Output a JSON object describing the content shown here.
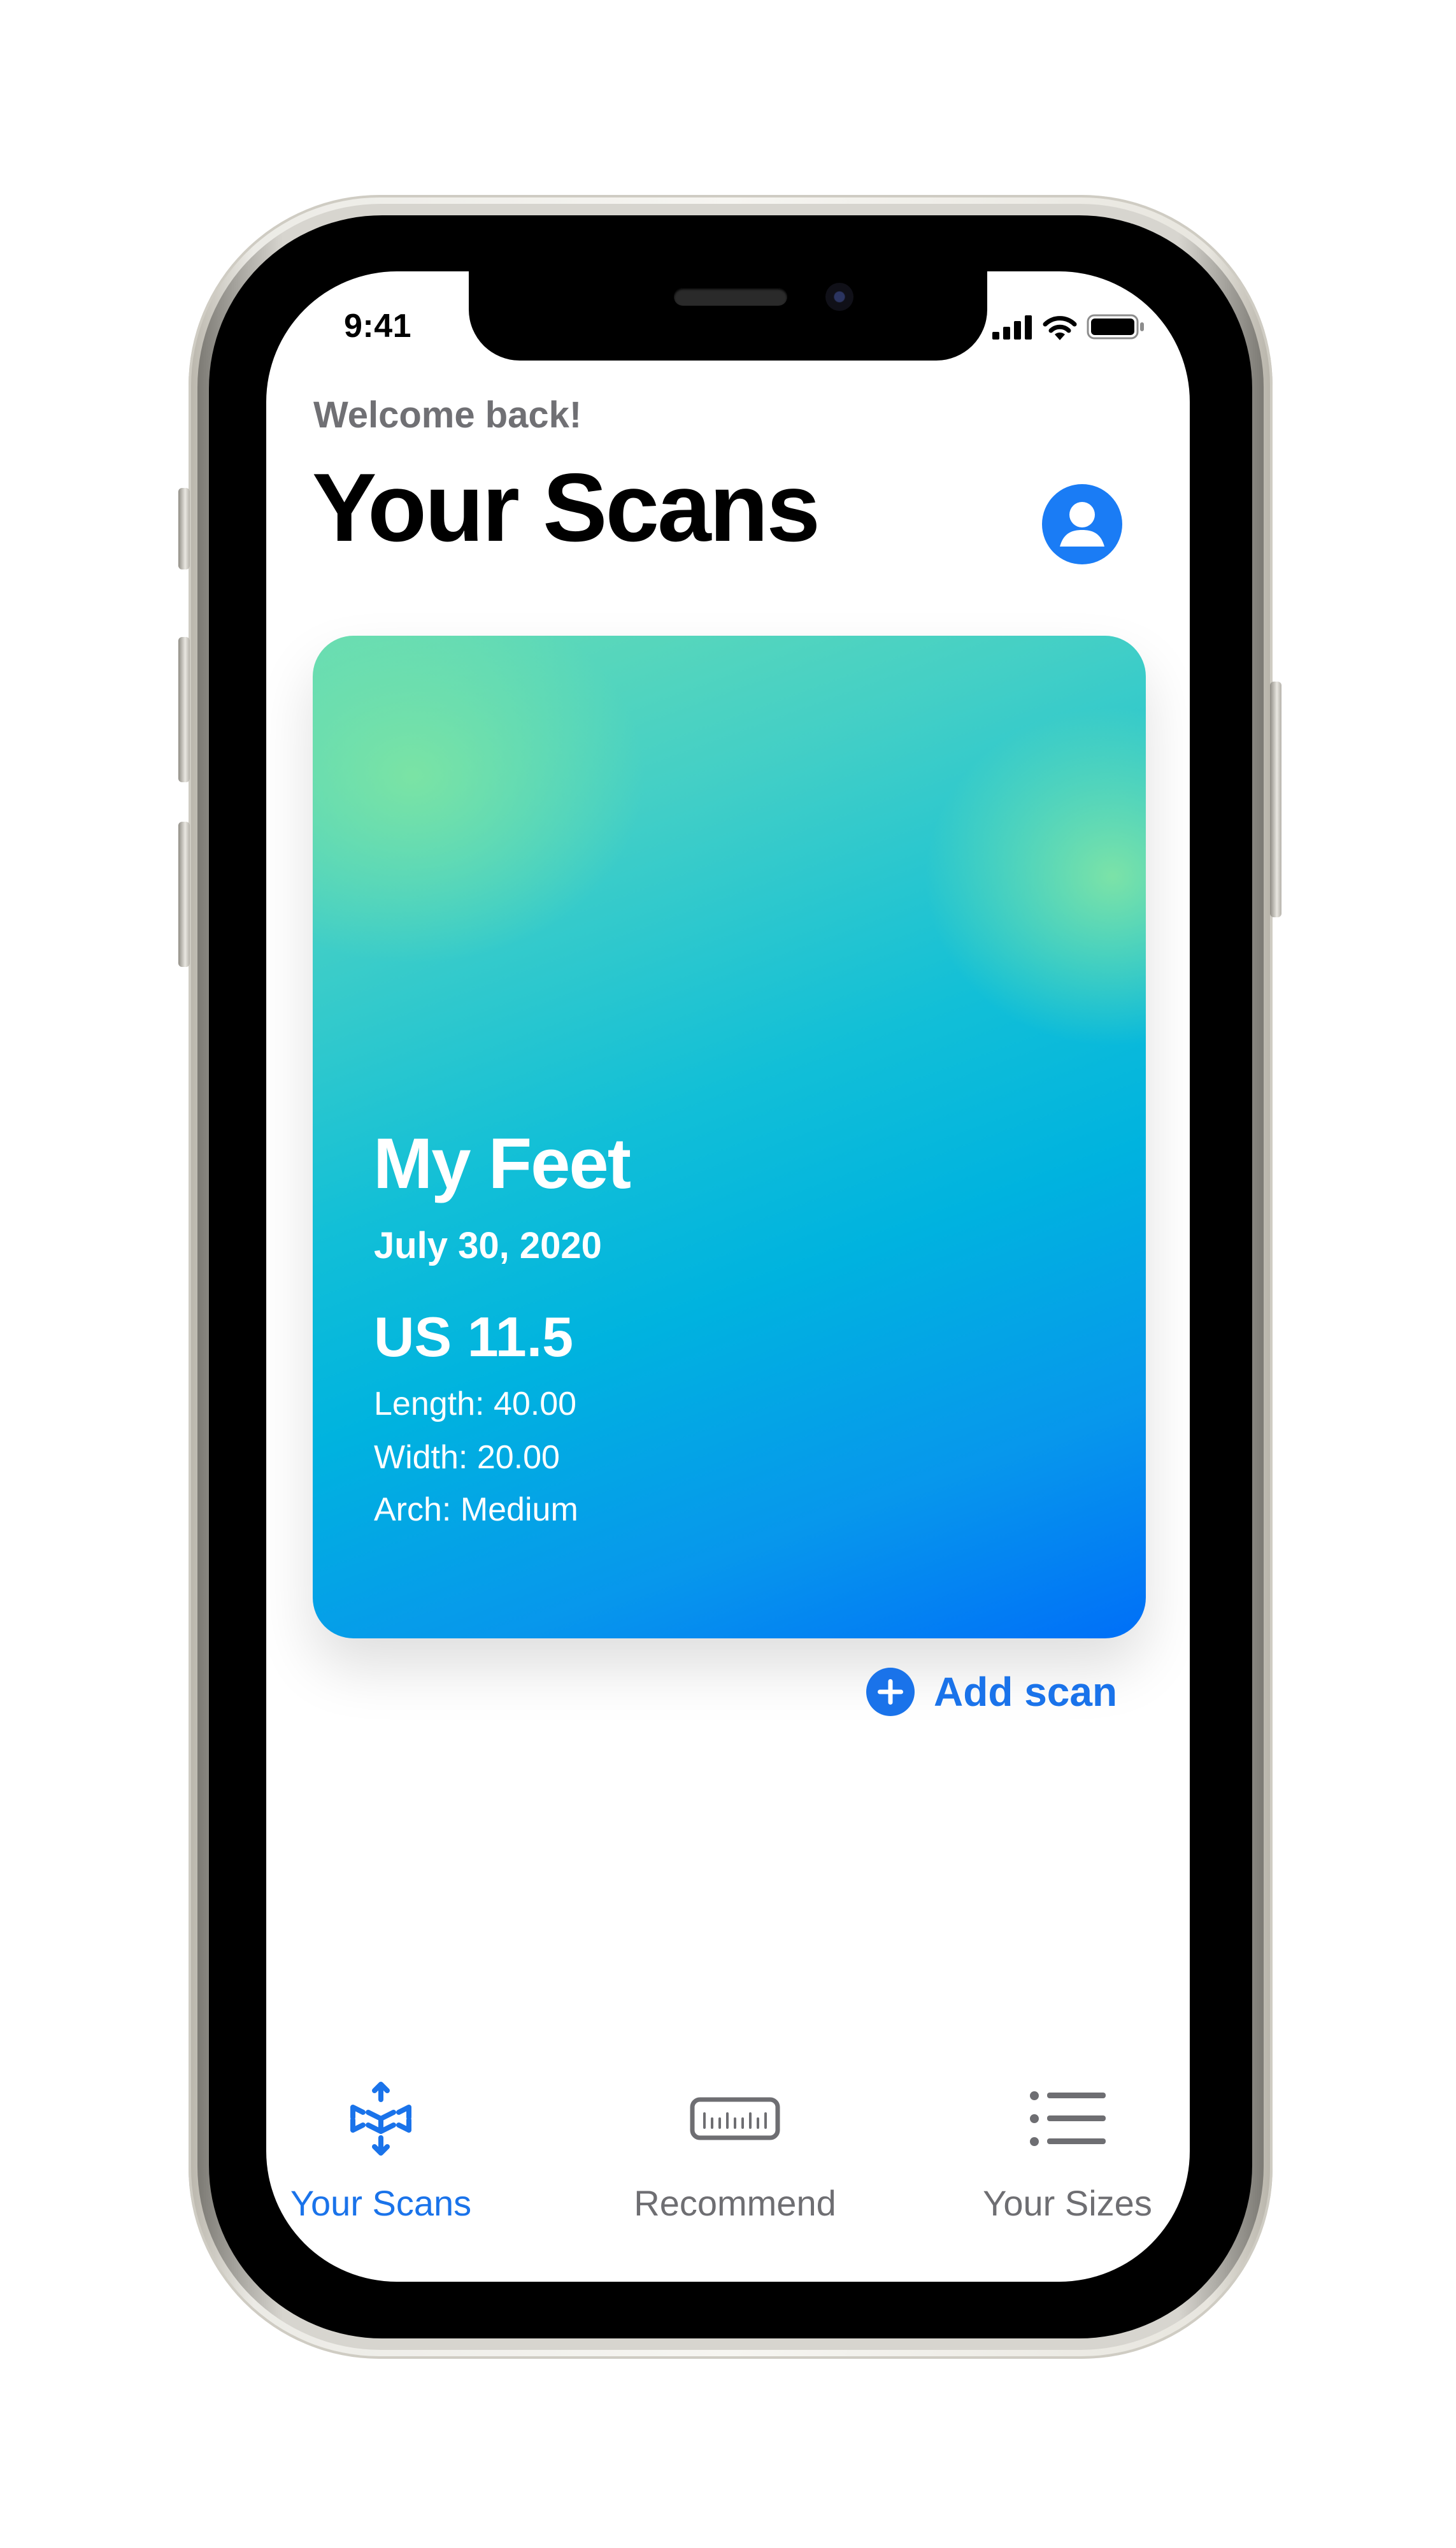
{
  "status_bar": {
    "time": "9:41"
  },
  "header": {
    "welcome": "Welcome back!",
    "title": "Your Scans",
    "profile_icon": "person-circle-icon"
  },
  "scan_card": {
    "title": "My Feet",
    "date": "July 30, 2020",
    "size": "US 11.5",
    "length": "Length: 40.00",
    "width": "Width: 20.00",
    "arch": "Arch: Medium",
    "gradient_colors": [
      "#7fe6a6",
      "#14bfd8",
      "#006ff8"
    ]
  },
  "add_scan": {
    "label": "Add scan",
    "icon": "plus-circle-icon"
  },
  "tab_bar": {
    "active_color": "#1a73ea",
    "inactive_color": "#6e6e72",
    "tabs": [
      {
        "label": "Your Scans",
        "icon": "scan-icon",
        "active": true
      },
      {
        "label": "Recommend",
        "icon": "ruler-icon",
        "active": false
      },
      {
        "label": "Your Sizes",
        "icon": "list-icon",
        "active": false
      }
    ]
  }
}
